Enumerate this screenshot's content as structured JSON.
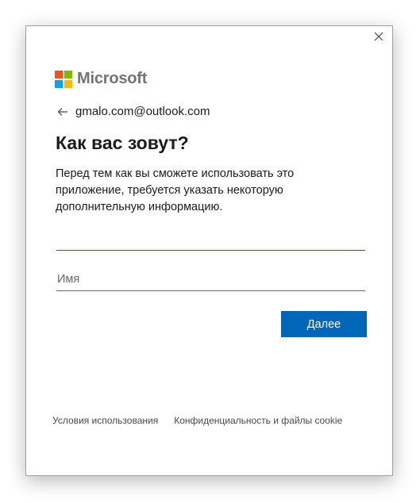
{
  "dialog": {
    "brand": "Microsoft",
    "account_email": "gmalo.com@outlook.com",
    "title": "Как вас зовут?",
    "description": "Перед тем как вы сможете использовать это приложение, требуется указать некоторую дополнительную информацию.",
    "surname_input": {
      "value": "",
      "placeholder": ""
    },
    "name_input": {
      "value": "",
      "placeholder": "Имя"
    },
    "next_label": "Далее"
  },
  "footer": {
    "terms": "Условия использования",
    "privacy": "Конфиденциальность и файлы cookie"
  },
  "colors": {
    "accent": "#0067b8",
    "logo_red": "#f25022",
    "logo_green": "#7fba00",
    "logo_blue": "#00a4ef",
    "logo_yellow": "#ffb900"
  },
  "icons": {
    "close": "close-icon",
    "back": "back-arrow-icon"
  }
}
